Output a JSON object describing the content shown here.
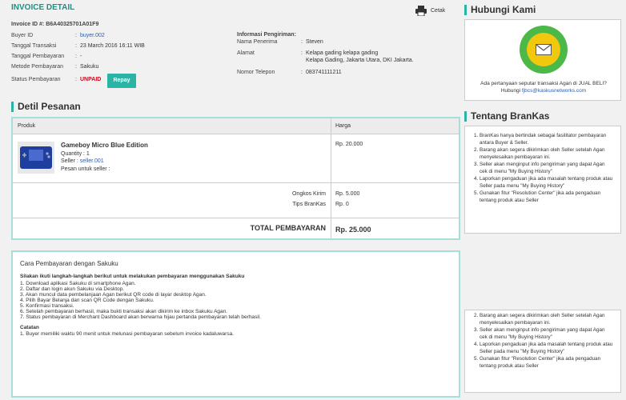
{
  "invoice": {
    "header_title": "INVOICE DETAIL",
    "print_label": "Cetak",
    "invoice_id_label": "Invoice ID #:",
    "invoice_id": "B6A40325701A01F9",
    "fields": [
      {
        "label": "Buyer ID",
        "value": "buyer.002"
      },
      {
        "label": "Tanggal Transaksi",
        "value": "23 March 2016 16:11 WIB"
      },
      {
        "label": "Tanggal Pembayaran",
        "value": "-"
      },
      {
        "label": "Metode Pembayaran",
        "value": "Sakuku"
      },
      {
        "label": "Status Pembayaran",
        "value": "UNPAID"
      }
    ],
    "repay_label": "Repay",
    "shipping": {
      "title": "Informasi Pengiriman:",
      "recipient_label": "Nama Penerima",
      "recipient": "Steven",
      "address_label": "Alamat",
      "address_line1": "Kelapa gading kelapa gading",
      "address_line2": "Kelapa Gading, Jakarta Utara, DKI Jakarta.",
      "phone_label": "Nomor Telepon",
      "phone": "083741111211"
    }
  },
  "order": {
    "section_title": "Detil Pesanan",
    "col_product": "Produk",
    "col_price": "Harga",
    "product_name": "Gameboy Micro Blue Edition",
    "quantity": "Quantity : 1",
    "seller_prefix": "Seller : ",
    "seller": "seller.001",
    "note": "Pesan untuk seller :",
    "price": "Rp. 20.000",
    "shipping_label": "Ongkos Kirim",
    "shipping_value": "Rp. 5.000",
    "tip_label": "Tips BranKas",
    "tip_value": "Rp. 0",
    "total_label": "TOTAL PEMBAYARAN",
    "total_value": "Rp. 25.000"
  },
  "payment": {
    "title": "Cara Pembayaran dengan Sakuku",
    "intro": "Silakan ikuti langkah-langkah berikut untuk melakukan pembayaran menggunakan Sakuku",
    "steps": [
      "1. Download aplikasi Sakuku di smartphone Agan.",
      "2. Daftar dan login akun Sakuku via Desktop.",
      "3. Akan muncul data pembelanjaan Agan berikut QR code di layar desktop Agan.",
      "4. Pilih Bayar Belanja dan scan QR Code dengan Sakuku.",
      "5. Konfirmasi transaksi.",
      "6. Setelah pembayaran berhasil, maka bukti transaksi akan dikirim ke inbox Sakuku Agan.",
      "7. Status pembayaran di Merchant Dashboard akan berwarna hijau pertanda pembayaran telah berhasil."
    ],
    "notes_title": "Catatan",
    "notes": [
      "1. Buyer memiliki waktu 90 menit untuk melunasi pembayaran sebelum invoice kadaluwarsa."
    ]
  },
  "contact": {
    "title": "Hubungi Kami",
    "text": "Ada pertanyaan seputar transaksi Agan di JUAL BELI? Hubungi",
    "email": "fjbcs@kaskusnetworks.com"
  },
  "about": {
    "title": "Tentang BranKas",
    "items": [
      "BranKas hanya bertindak sebagai fasilitator pembayaran antara Buyer & Seller.",
      "Barang akan segera dikirimkan oleh Seller setelah Agan menyelesaikan pembayaran ini.",
      "Seller akan menginput info pengiriman yang dapat Agan cek di menu \"My Buying History\"",
      "Laporkan pengaduan jika ada masalah tentang produk atau Seller pada menu \"My Buying History\"",
      "Gunakan fitur \"Resolution Center\" jika ada pengaduan tentang produk atau Seller"
    ],
    "items_repeat": [
      "Barang akan segera dikirimkan oleh Seller setelah Agan menyelesaikan pembayaran ini.",
      "Seller akan menginput info pengiriman yang dapat Agan cek di menu \"My Buying History\"",
      "Laporkan pengaduan jika ada masalah tentang produk atau Seller pada menu \"My Buying History\"",
      "Gunakan fitur \"Resolution Center\" jika ada pengaduan tentang produk atau Seller"
    ]
  },
  "colors": {
    "accent": "#2bb3a6",
    "unpaid": "#d0021b",
    "icon_green": "#4cb847",
    "icon_yellow": "#f2c80f"
  }
}
